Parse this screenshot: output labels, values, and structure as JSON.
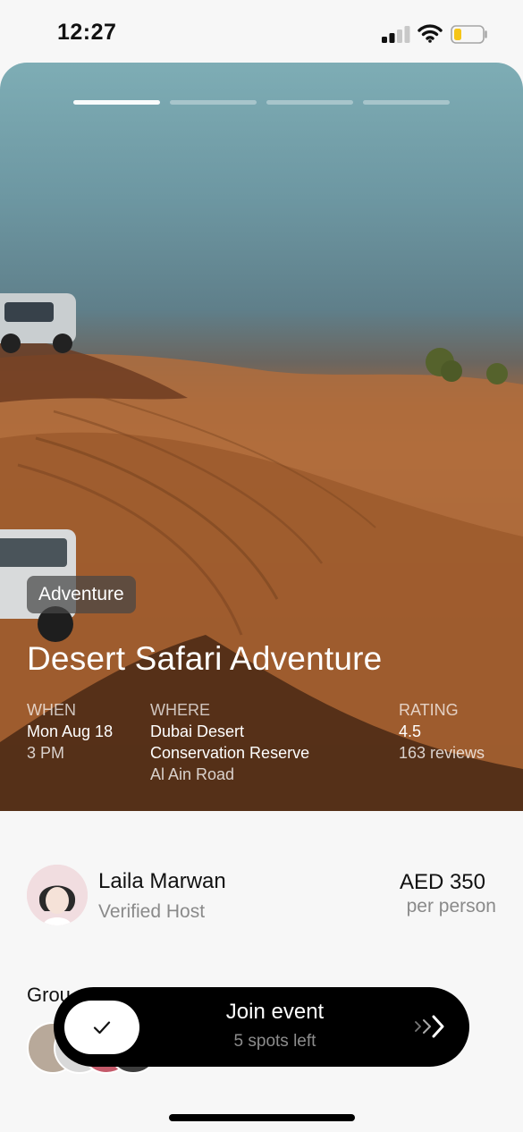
{
  "status_bar": {
    "time": "12:27"
  },
  "hero": {
    "story_count": 4,
    "active_story": 0,
    "tag": "Adventure",
    "title": "Desert Safari Adventure",
    "when": {
      "label": "WHEN",
      "line1": "Mon Aug 18",
      "line2": "3 PM"
    },
    "where": {
      "label": "WHERE",
      "line1": "Dubai Desert",
      "line2": "Conservation Reserve",
      "line3": "Al Ain Road"
    },
    "rating": {
      "label": "RATING",
      "value": "4.5",
      "reviews": "163 reviews"
    }
  },
  "host": {
    "name": "Laila Marwan",
    "subtitle": "Verified Host"
  },
  "price": {
    "amount": "AED 350",
    "unit": "per person"
  },
  "group": {
    "label": "Grou"
  },
  "join": {
    "title": "Join event",
    "subtitle": "5 spots left"
  },
  "colors": {
    "accent": "#000000",
    "battery": "#f5c518"
  }
}
